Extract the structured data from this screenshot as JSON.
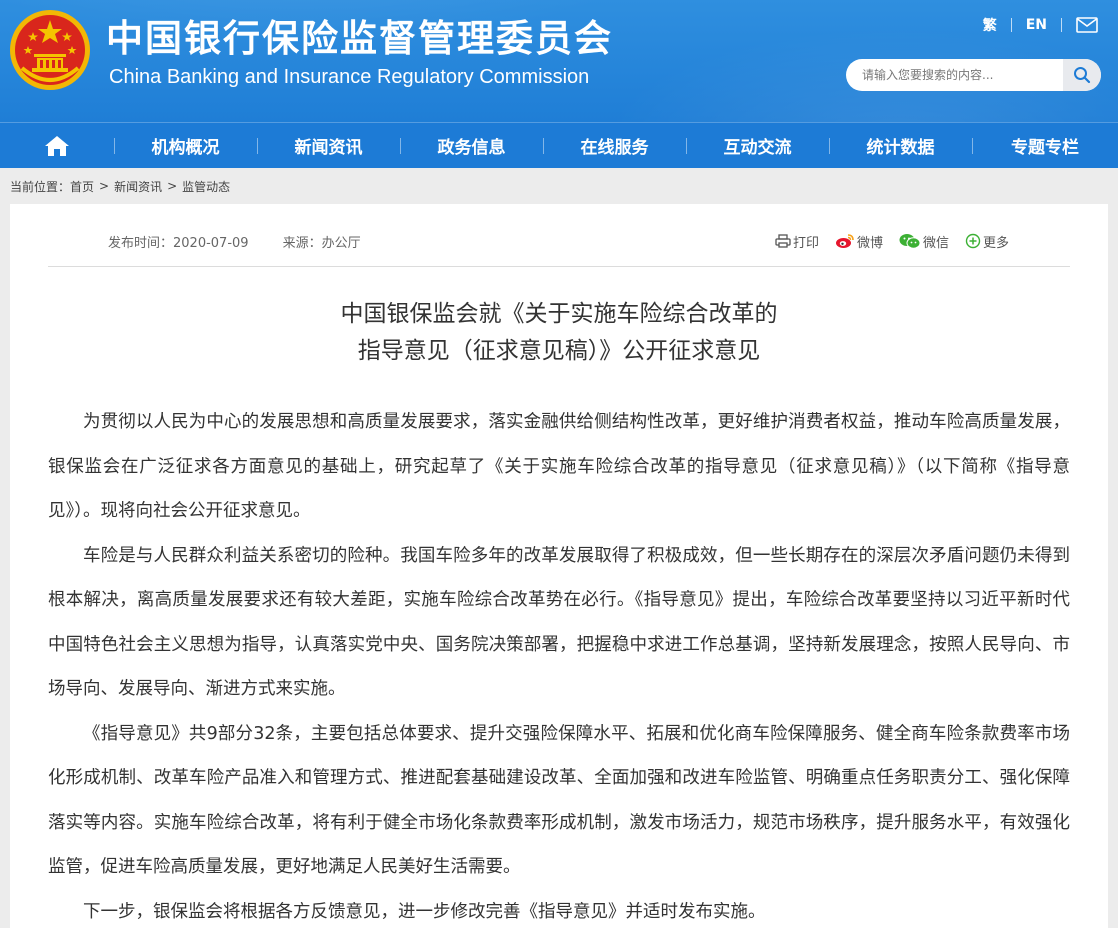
{
  "header": {
    "title_cn": "中国银行保险监督管理委员会",
    "title_en": "China Banking and Insurance Regulatory Commission",
    "lang_traditional": "繁",
    "lang_english": "EN",
    "emblem_icon": "national-emblem-icon",
    "mail_icon": "mail-icon"
  },
  "search": {
    "placeholder": "请输入您要搜索的内容...",
    "icon": "search-icon"
  },
  "nav": {
    "home_icon": "home-icon",
    "items": [
      "机构概况",
      "新闻资讯",
      "政务信息",
      "在线服务",
      "互动交流",
      "统计数据",
      "专题专栏"
    ]
  },
  "breadcrumb": {
    "label": "当前位置：",
    "items": [
      "首页",
      "新闻资讯",
      "监管动态"
    ],
    "separator": ">"
  },
  "article": {
    "publish_time": "发布时间：2020-07-09",
    "source": "来源：办公厅",
    "share": {
      "print": "打印",
      "weibo": "微博",
      "wechat": "微信",
      "more": "更多"
    },
    "title_line1": "中国银保监会就《关于实施车险综合改革的",
    "title_line2": "指导意见（征求意见稿）》公开征求意见",
    "paragraphs": [
      "为贯彻以人民为中心的发展思想和高质量发展要求，落实金融供给侧结构性改革，更好维护消费者权益，推动车险高质量发展，银保监会在广泛征求各方面意见的基础上，研究起草了《关于实施车险综合改革的指导意见（征求意见稿）》（以下简称《指导意见》）。现将向社会公开征求意见。",
      "车险是与人民群众利益关系密切的险种。我国车险多年的改革发展取得了积极成效，但一些长期存在的深层次矛盾问题仍未得到根本解决，离高质量发展要求还有较大差距，实施车险综合改革势在必行。《指导意见》提出，车险综合改革要坚持以习近平新时代中国特色社会主义思想为指导，认真落实党中央、国务院决策部署，把握稳中求进工作总基调，坚持新发展理念，按照人民导向、市场导向、发展导向、渐进方式来实施。",
      "《指导意见》共9部分32条，主要包括总体要求、提升交强险保障水平、拓展和优化商车险保障服务、健全商车险条款费率市场化形成机制、改革车险产品准入和管理方式、推进配套基础建设改革、全面加强和改进车险监管、明确重点任务职责分工、强化保障落实等内容。实施车险综合改革，将有利于健全市场化条款费率形成机制，激发市场活力，规范市场秩序，提升服务水平，有效强化监管，促进车险高质量发展，更好地满足人民美好生活需要。",
      "下一步，银保监会将根据各方反馈意见，进一步修改完善《指导意见》并适时发布实施。"
    ]
  },
  "colors": {
    "header_blue": "#2f8fdf",
    "nav_blue": "#1d7bd6",
    "emblem_red": "#d9261c",
    "emblem_gold": "#f5c400"
  }
}
